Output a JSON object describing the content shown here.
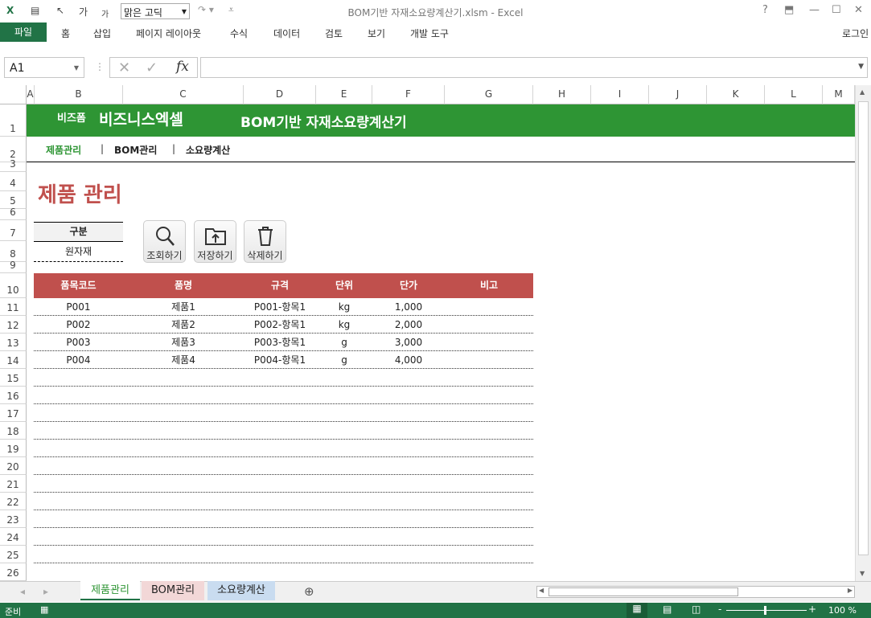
{
  "app": {
    "title": "BOM기반 자재소요량계산기.xlsm - Excel",
    "font_name": "맑은 고딕",
    "login": "로그인",
    "help": "?"
  },
  "ribbon": {
    "tabs": [
      "파일",
      "홈",
      "삽입",
      "페이지 레이아웃",
      "수식",
      "데이터",
      "검토",
      "보기",
      "개발 도구"
    ]
  },
  "formula": {
    "name_box": "A1",
    "fx": "fx",
    "value": ""
  },
  "columns": [
    "A",
    "B",
    "C",
    "D",
    "E",
    "F",
    "G",
    "H",
    "I",
    "J",
    "K",
    "L",
    "M"
  ],
  "rows": [
    "1",
    "2",
    "3",
    "4",
    "5",
    "6",
    "7",
    "8",
    "9",
    "10",
    "11",
    "12",
    "13",
    "14",
    "15",
    "16",
    "17",
    "18",
    "19",
    "20",
    "21",
    "22",
    "23",
    "24",
    "25",
    "26"
  ],
  "sheet": {
    "brand_small": "비즈폼",
    "brand": "비즈니스엑셀",
    "header_title": "BOM기반 자재소요량계산기",
    "nav": [
      "제품관리",
      "BOM관리",
      "소요량계산"
    ],
    "page_title": "제품 관리",
    "filter_label": "구분",
    "filter_value": "원자재",
    "buttons": {
      "search": "조회하기",
      "save": "저장하기",
      "delete": "삭제하기"
    },
    "table": {
      "headers": [
        "품목코드",
        "품명",
        "규격",
        "단위",
        "단가",
        "비고"
      ],
      "rows": [
        [
          "P001",
          "제품1",
          "P001-항목1",
          "kg",
          "1,000",
          ""
        ],
        [
          "P002",
          "제품2",
          "P002-항목1",
          "kg",
          "2,000",
          ""
        ],
        [
          "P003",
          "제품3",
          "P003-항목1",
          "g",
          "3,000",
          ""
        ],
        [
          "P004",
          "제품4",
          "P004-항목1",
          "g",
          "4,000",
          ""
        ]
      ]
    }
  },
  "sheet_tabs": [
    "제품관리",
    "BOM관리",
    "소요량계산"
  ],
  "status": {
    "ready": "준비",
    "zoom": "100 %"
  },
  "colors": {
    "excel_green": "#217346",
    "header_green": "#2e9534",
    "table_red": "#c0504d",
    "title_red": "#c0504d"
  }
}
